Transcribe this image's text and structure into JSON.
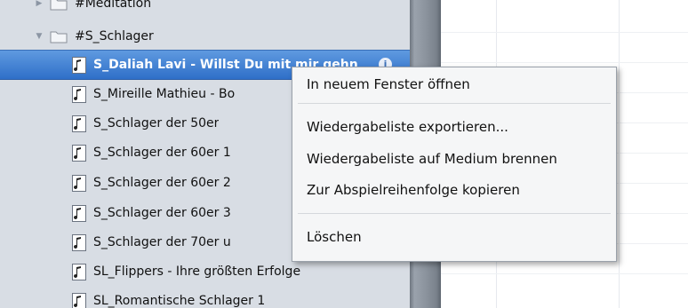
{
  "sidebar": {
    "rows": [
      {
        "kind": "folder",
        "label": "#Meditation",
        "expanded": false
      },
      {
        "kind": "folder",
        "label": "#S_Schlager",
        "expanded": true
      },
      {
        "kind": "playlist",
        "label": "S_Daliah Lavi - Willst Du mit mir gehn",
        "selected": true
      },
      {
        "kind": "playlist",
        "label": "S_Mireille Mathieu - Bo"
      },
      {
        "kind": "playlist",
        "label": "S_Schlager der 50er"
      },
      {
        "kind": "playlist",
        "label": "S_Schlager der 60er 1"
      },
      {
        "kind": "playlist",
        "label": "S_Schlager der 60er 2"
      },
      {
        "kind": "playlist",
        "label": "S_Schlager der 60er 3"
      },
      {
        "kind": "playlist",
        "label": "S_Schlager der 70er u"
      },
      {
        "kind": "playlist",
        "label": "SL_Flippers - Ihre größten Erfolge"
      },
      {
        "kind": "playlist",
        "label": "SL_Romantische Schlager 1"
      }
    ]
  },
  "context_menu": {
    "items": [
      {
        "label": "In neuem Fenster öffnen"
      },
      {
        "label": "Wiedergabeliste exportieren..."
      },
      {
        "label": "Wiedergabeliste auf Medium brennen"
      },
      {
        "label": "Zur Abspielreihenfolge kopieren"
      },
      {
        "label": "Löschen"
      }
    ]
  },
  "icons": {
    "folder": "folder-icon",
    "playlist": "playlist-note-icon",
    "info": "info-icon",
    "disclosure_collapsed": "disclosure-right-icon",
    "disclosure_expanded": "disclosure-down-icon"
  },
  "colors": {
    "sidebar_bg": "#d8dde4",
    "selection": "#2f6fc8",
    "menu_bg": "#f5f6f7",
    "splitter": "#8c949e"
  }
}
